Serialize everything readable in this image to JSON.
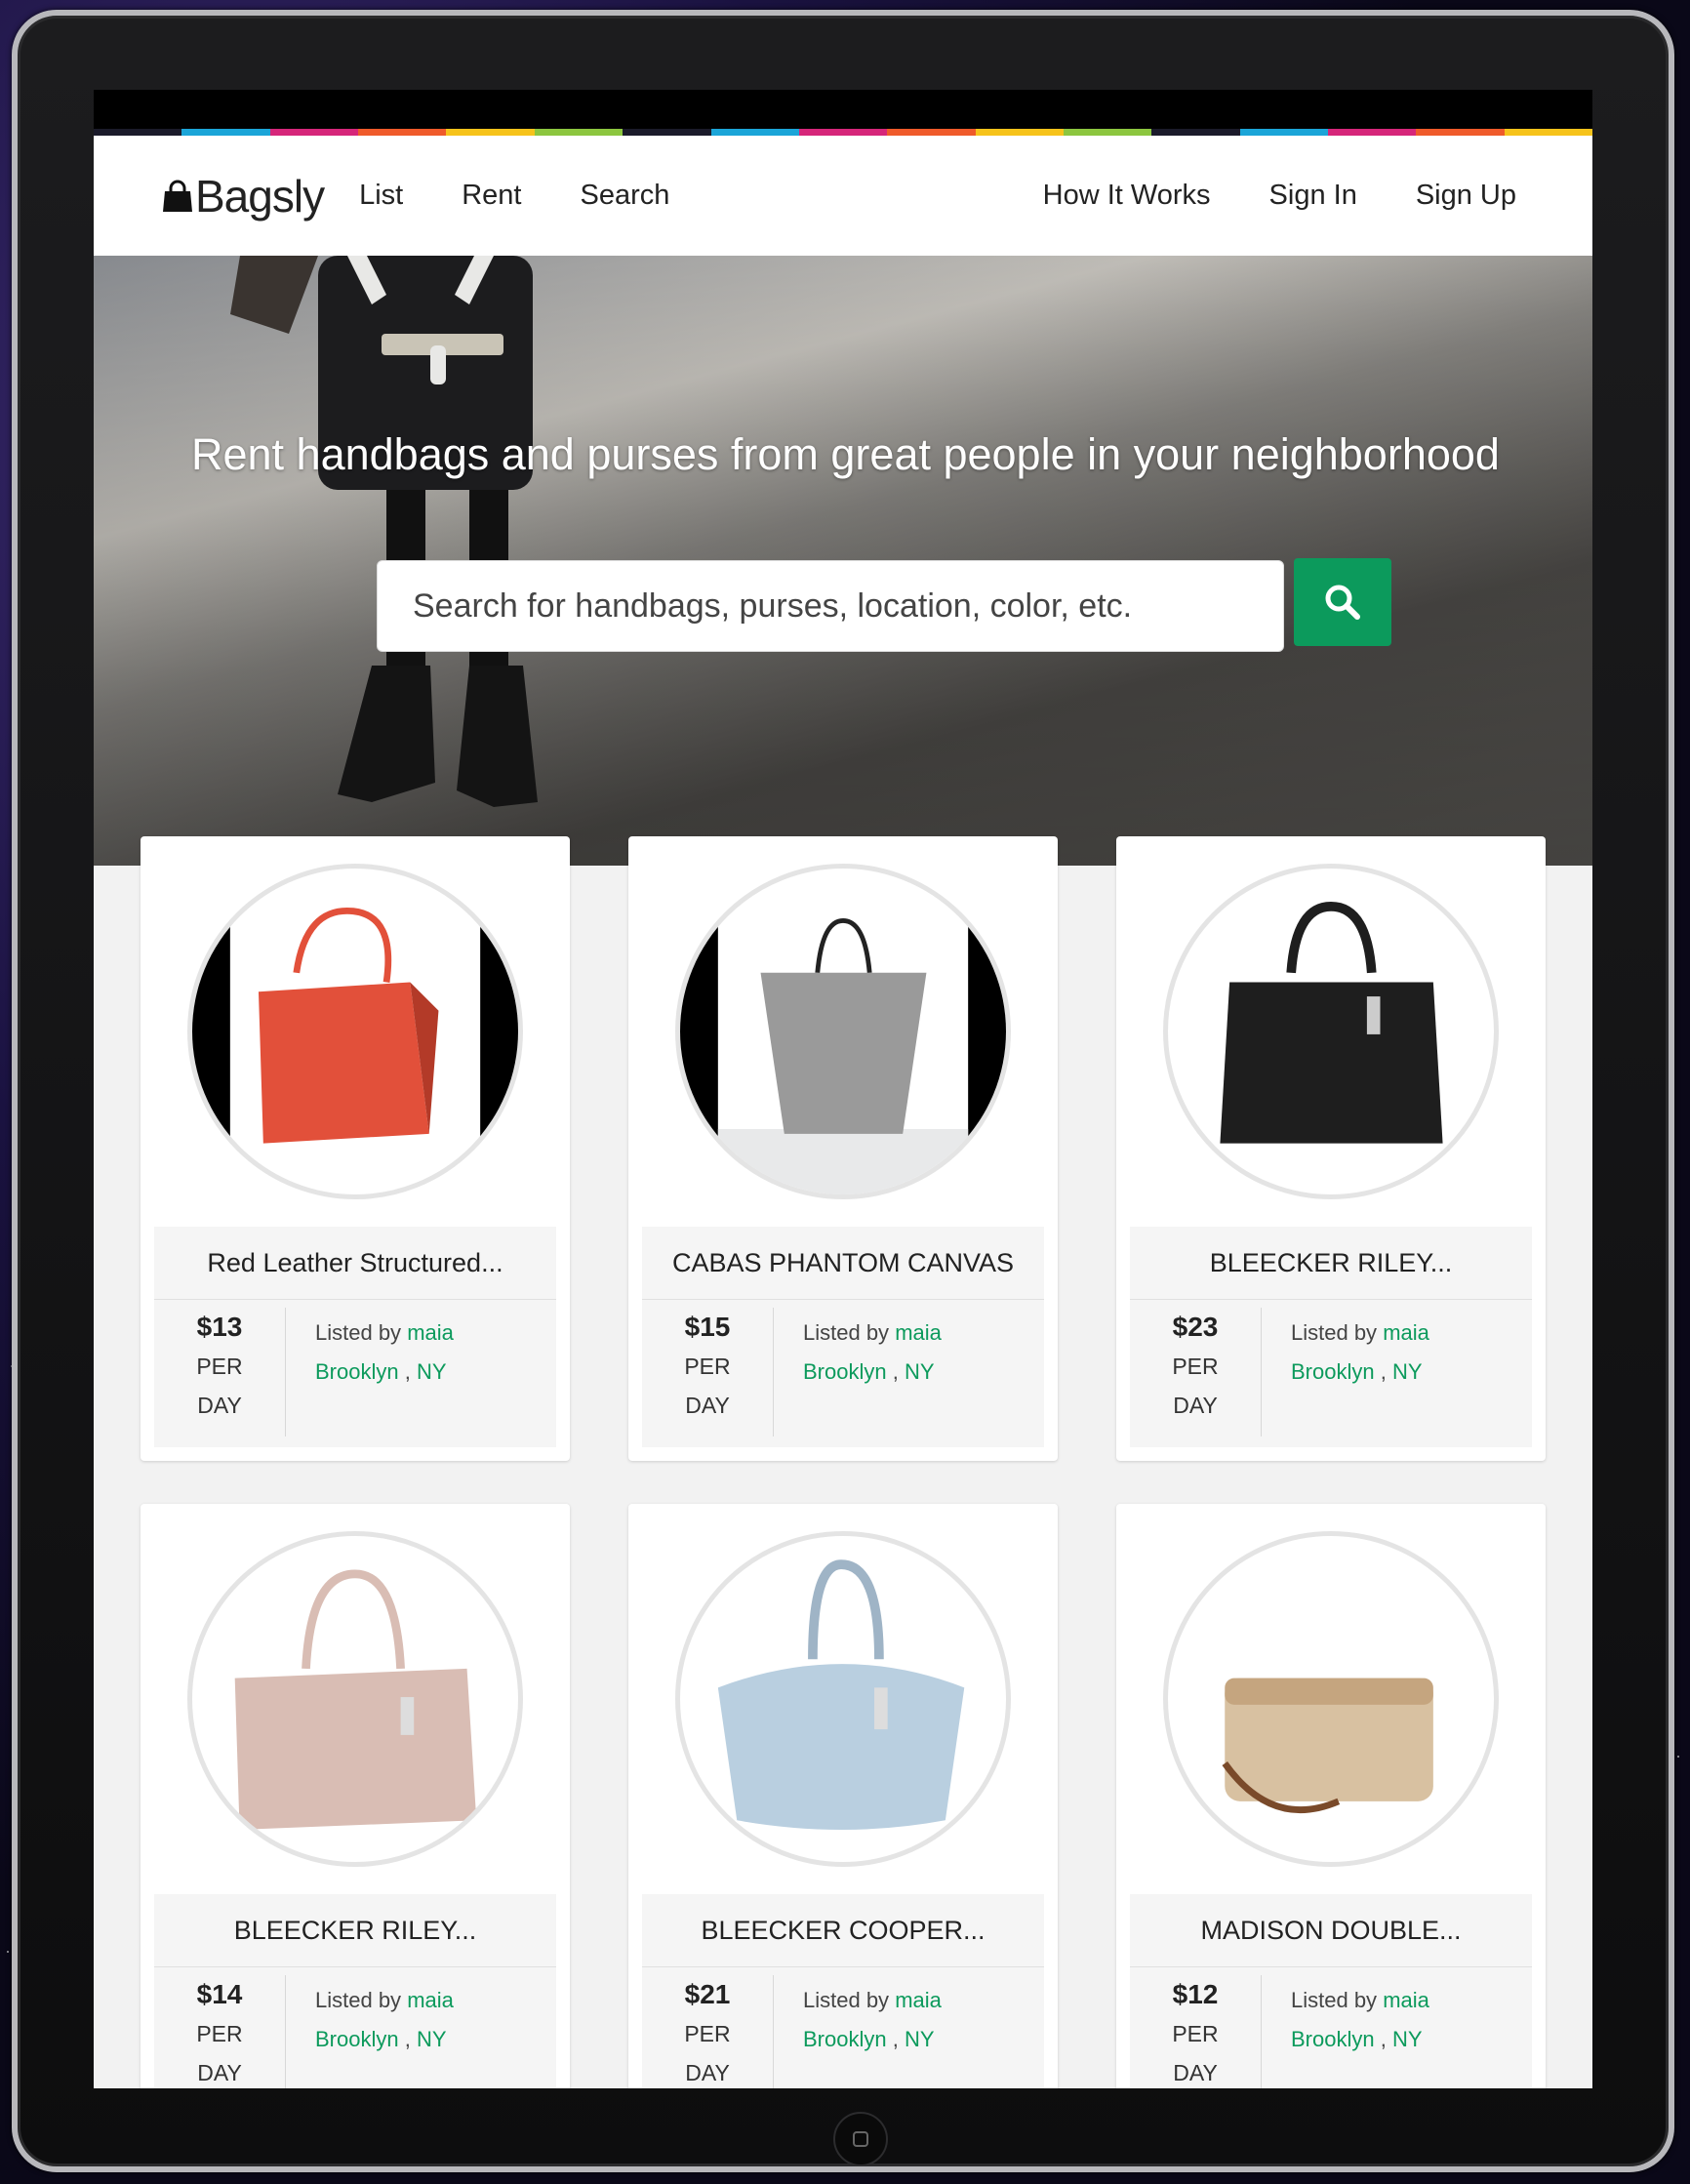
{
  "brand": {
    "name": "Bagsly"
  },
  "colorbar": [
    "#1a1a2a",
    "#1ba5d8",
    "#d6267a",
    "#ef5a2a",
    "#f6c31b",
    "#8cc63f",
    "#1a1a2a",
    "#1ba5d8",
    "#d6267a",
    "#ef5a2a",
    "#f6c31b",
    "#8cc63f",
    "#1a1a2a",
    "#1ba5d8",
    "#d6267a",
    "#ef5a2a",
    "#f6c31b"
  ],
  "nav": {
    "left": [
      "List",
      "Rent",
      "Search"
    ],
    "right": [
      "How It Works",
      "Sign In",
      "Sign Up"
    ]
  },
  "hero": {
    "title": "Rent handbags and purses from great people in your neighborhood",
    "search_placeholder": "Search for handbags, purses, location, color, etc."
  },
  "listing_labels": {
    "listed_by": "Listed by",
    "per": "PER",
    "day": "DAY",
    "separator": " , "
  },
  "listings": [
    {
      "title": "Red Leather Structured...",
      "price": "$13",
      "owner": "maia",
      "city": "Brooklyn",
      "state": "NY",
      "bag_color": "#e2503a"
    },
    {
      "title": "CABAS PHANTOM CANVAS",
      "price": "$15",
      "owner": "maia",
      "city": "Brooklyn",
      "state": "NY",
      "bag_color": "#9a9a9a"
    },
    {
      "title": "BLEECKER RILEY...",
      "price": "$23",
      "owner": "maia",
      "city": "Brooklyn",
      "state": "NY",
      "bag_color": "#1e1e1e"
    },
    {
      "title": "BLEECKER RILEY...",
      "price": "$14",
      "owner": "maia",
      "city": "Brooklyn",
      "state": "NY",
      "bag_color": "#d9bdb4"
    },
    {
      "title": "BLEECKER COOPER...",
      "price": "$21",
      "owner": "maia",
      "city": "Brooklyn",
      "state": "NY",
      "bag_color": "#b9cfe0"
    },
    {
      "title": "MADISON DOUBLE...",
      "price": "$12",
      "owner": "maia",
      "city": "Brooklyn",
      "state": "NY",
      "bag_color": "#d8c1a1"
    }
  ],
  "colors": {
    "accent": "#0c9a5c"
  }
}
